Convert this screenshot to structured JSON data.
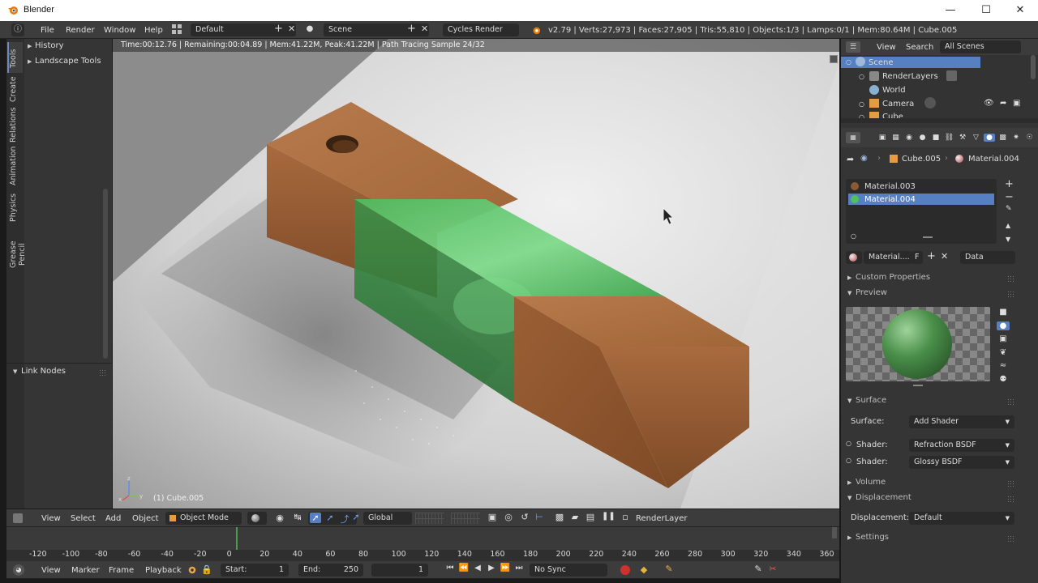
{
  "window": {
    "title": "Blender"
  },
  "menu": {
    "items": [
      "File",
      "Render",
      "Window",
      "Help"
    ],
    "layout": "Default",
    "scene": "Scene",
    "engine": "Cycles Render",
    "stats": "v2.79 | Verts:27,973 | Faces:27,905 | Tris:55,810 | Objects:1/3 | Lamps:0/1 | Mem:80.64M | Cube.005"
  },
  "tool_tabs": [
    "Tools",
    "Create",
    "Relations",
    "Animation",
    "Physics",
    "Grease Pencil"
  ],
  "tools": {
    "history": "History",
    "landscape": "Landscape Tools",
    "link_nodes": "Link Nodes"
  },
  "viewport": {
    "render_info": "Time:00:12.76 | Remaining:00:04.89 | Mem:41.22M, Peak:41.22M | Path Tracing Sample 24/32",
    "object_label": "(1) Cube.005"
  },
  "view_header": {
    "view": "View",
    "select": "Select",
    "add": "Add",
    "object": "Object",
    "mode": "Object Mode",
    "orientation": "Global",
    "render_layer": "RenderLayer"
  },
  "ruler": [
    "-120",
    "-100",
    "-80",
    "-60",
    "-40",
    "-20",
    "0",
    "20",
    "40",
    "60",
    "80",
    "100",
    "120",
    "140",
    "160",
    "180",
    "200",
    "220",
    "240",
    "260",
    "280",
    "300",
    "320",
    "340",
    "360"
  ],
  "timeline": {
    "view": "View",
    "marker": "Marker",
    "frame": "Frame",
    "playback": "Playback",
    "start_label": "Start:",
    "start": "1",
    "end_label": "End:",
    "end": "250",
    "current": "1",
    "sync": "No Sync"
  },
  "outliner": {
    "view": "View",
    "search": "Search",
    "filter": "All Scenes",
    "items": [
      "Scene",
      "RenderLayers",
      "World",
      "Camera",
      "Cube"
    ]
  },
  "properties": {
    "object": "Cube.005",
    "material": "Material.004",
    "slots": [
      "Material.003",
      "Material.004"
    ],
    "mat_field": "Material....",
    "mat_users": "F",
    "link": "Data",
    "custom_props": "Custom Properties",
    "preview": "Preview",
    "surface": "Surface",
    "surface_label": "Surface:",
    "surface_val": "Add Shader",
    "shader_label": "Shader:",
    "shader1": "Refraction BSDF",
    "shader2": "Glossy BSDF",
    "volume": "Volume",
    "displacement": "Displacement",
    "displacement_label": "Displacement:",
    "displacement_val": "Default",
    "settings": "Settings"
  },
  "colors": {
    "selection": "#5680c2",
    "wood": "#a8693f",
    "glass": "#3aa844",
    "header": "#3c3c3c"
  }
}
